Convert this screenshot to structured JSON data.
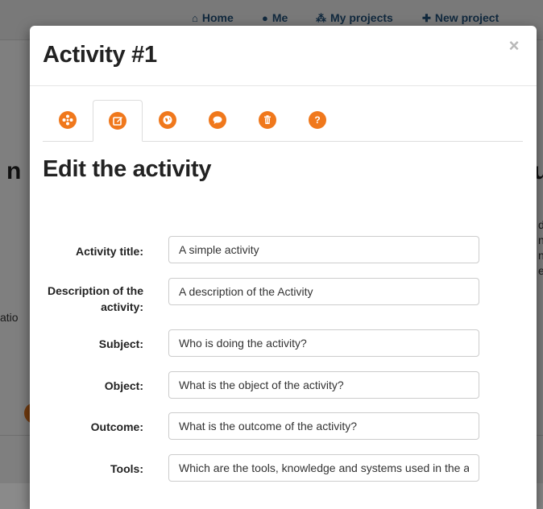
{
  "nav": {
    "home": "Home",
    "me": "Me",
    "my_projects": "My projects",
    "new_project": "New project"
  },
  "background": {
    "frag_left_big": "n",
    "frag_right_big": "u",
    "frag_left_small": "atio",
    "frag_right_lines": [
      "do",
      "n",
      "nc",
      "er"
    ]
  },
  "modal": {
    "title": "Activity #1",
    "close_label": "×",
    "tabs": [
      {
        "name": "overview",
        "icon": "network-icon",
        "active": false
      },
      {
        "name": "edit",
        "icon": "edit-icon",
        "active": true
      },
      {
        "name": "globe",
        "icon": "globe-icon",
        "active": false
      },
      {
        "name": "comments",
        "icon": "comment-icon",
        "active": false
      },
      {
        "name": "delete",
        "icon": "trash-icon",
        "active": false
      },
      {
        "name": "help",
        "icon": "question-icon",
        "label": "?",
        "active": false
      }
    ],
    "section_title": "Edit the activity",
    "fields": [
      {
        "label": "Activity title:",
        "value": "A simple activity",
        "placeholder": ""
      },
      {
        "label": "Description of the activity:",
        "value": "A description of the Activity",
        "placeholder": ""
      },
      {
        "label": "Subject:",
        "value": "Who is doing the activity?",
        "placeholder": ""
      },
      {
        "label": "Object:",
        "value": "What is the object of the activity?",
        "placeholder": ""
      },
      {
        "label": "Outcome:",
        "value": "What is the outcome of the activity?",
        "placeholder": ""
      },
      {
        "label": "Tools:",
        "value": "Which are the tools, knowledge and systems used in the activity?",
        "placeholder": ""
      }
    ]
  },
  "colors": {
    "accent": "#f0781c",
    "link": "#23527c",
    "backdrop": "rgba(0,0,0,0.5)"
  }
}
